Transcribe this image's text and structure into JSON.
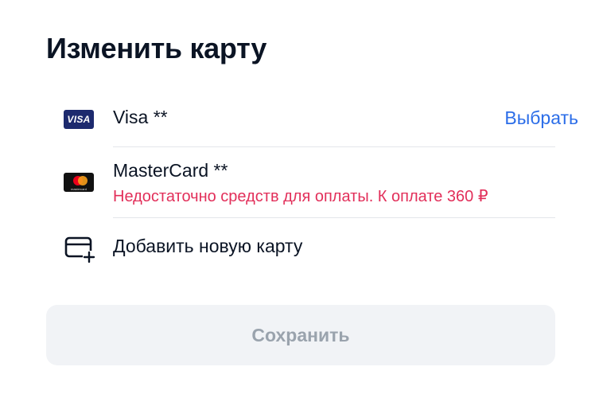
{
  "title": "Изменить карту",
  "cards": [
    {
      "brand": "Visa",
      "label": "Visa **",
      "badge_text": "VISA",
      "action": "Выбрать",
      "icon": "visa-logo-icon"
    },
    {
      "brand": "MasterCard",
      "label": "MasterCard **",
      "badge_text": "mastercard",
      "error": "Недостаточно средств для оплаты. К оплате 360 ₽",
      "icon": "mastercard-logo-icon"
    }
  ],
  "add_card": {
    "label": "Добавить новую карту",
    "icon": "add-card-icon"
  },
  "save_button": {
    "label": "Сохранить",
    "state": "disabled"
  },
  "colors": {
    "text": "#0b1424",
    "link": "#2b6de8",
    "error": "#e22f5a",
    "button_bg": "#f1f3f6",
    "button_text": "#9aa3ad",
    "visa_blue": "#1d2a6e"
  }
}
